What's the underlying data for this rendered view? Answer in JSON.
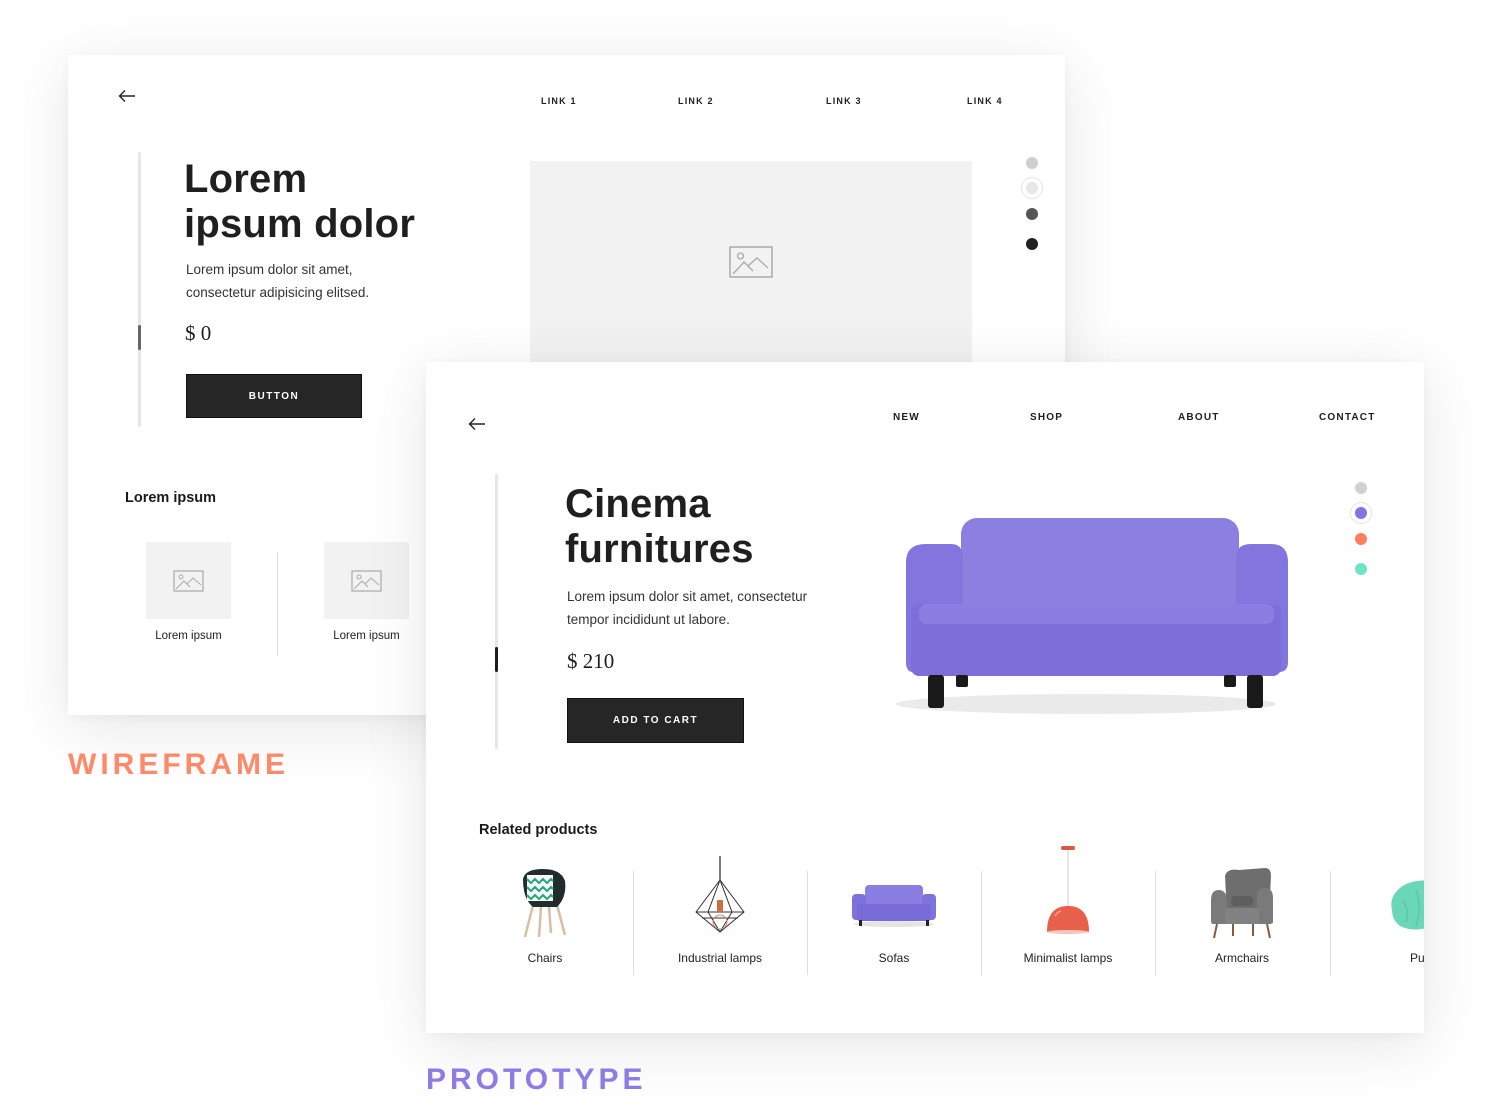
{
  "wireframe": {
    "nav_links": [
      "LINK 1",
      "LINK 2",
      "LINK 3",
      "LINK 4"
    ],
    "title_line1": "Lorem",
    "title_line2": "ipsum dolor",
    "description_line1": "Lorem ipsum dolor sit amet,",
    "description_line2": "consectetur adipisicing elitsed.",
    "price": "$ 0",
    "button_label": "BUTTON",
    "section_title": "Lorem ipsum",
    "items": [
      {
        "label": "Lorem ipsum",
        "icon": "image-placeholder-icon"
      },
      {
        "label": "Lorem ipsum",
        "icon": "image-placeholder-icon"
      }
    ],
    "swatches": [
      {
        "color": "#cfcfcf",
        "selected": false
      },
      {
        "color": "#e6e6e6",
        "selected": true
      },
      {
        "color": "#555555",
        "selected": false
      },
      {
        "color": "#222222",
        "selected": false
      }
    ],
    "scroll_position": 0.7,
    "caption": "WIREFRAME",
    "caption_color": "#ff8a6a"
  },
  "prototype": {
    "nav_links": [
      "NEW",
      "SHOP",
      "ABOUT",
      "CONTACT"
    ],
    "title_line1": "Cinema",
    "title_line2": "furnitures",
    "description_line1": "Lorem ipsum dolor sit amet, consectetur",
    "description_line2": "tempor incididunt ut labore.",
    "price": "$ 210",
    "button_label": "ADD TO CART",
    "hero_image": "purple-sofa",
    "section_title": "Related products",
    "products": [
      {
        "label": "Chairs",
        "icon": "chair-icon"
      },
      {
        "label": "Industrial lamps",
        "icon": "industrial-lamp-icon"
      },
      {
        "label": "Sofas",
        "icon": "sofa-icon"
      },
      {
        "label": "Minimalist lamps",
        "icon": "minimalist-lamp-icon"
      },
      {
        "label": "Armchairs",
        "icon": "armchair-icon"
      },
      {
        "label": "Pu",
        "icon": "pouf-icon"
      }
    ],
    "swatches": [
      {
        "color": "#d0d0d0",
        "selected": false
      },
      {
        "color": "#8474e0",
        "selected": true
      },
      {
        "color": "#ff7f5c",
        "selected": false
      },
      {
        "color": "#6fe3c6",
        "selected": false
      }
    ],
    "scroll_position": 0.7,
    "caption": "PROTOTYPE",
    "caption_color": "#8d7be6"
  }
}
